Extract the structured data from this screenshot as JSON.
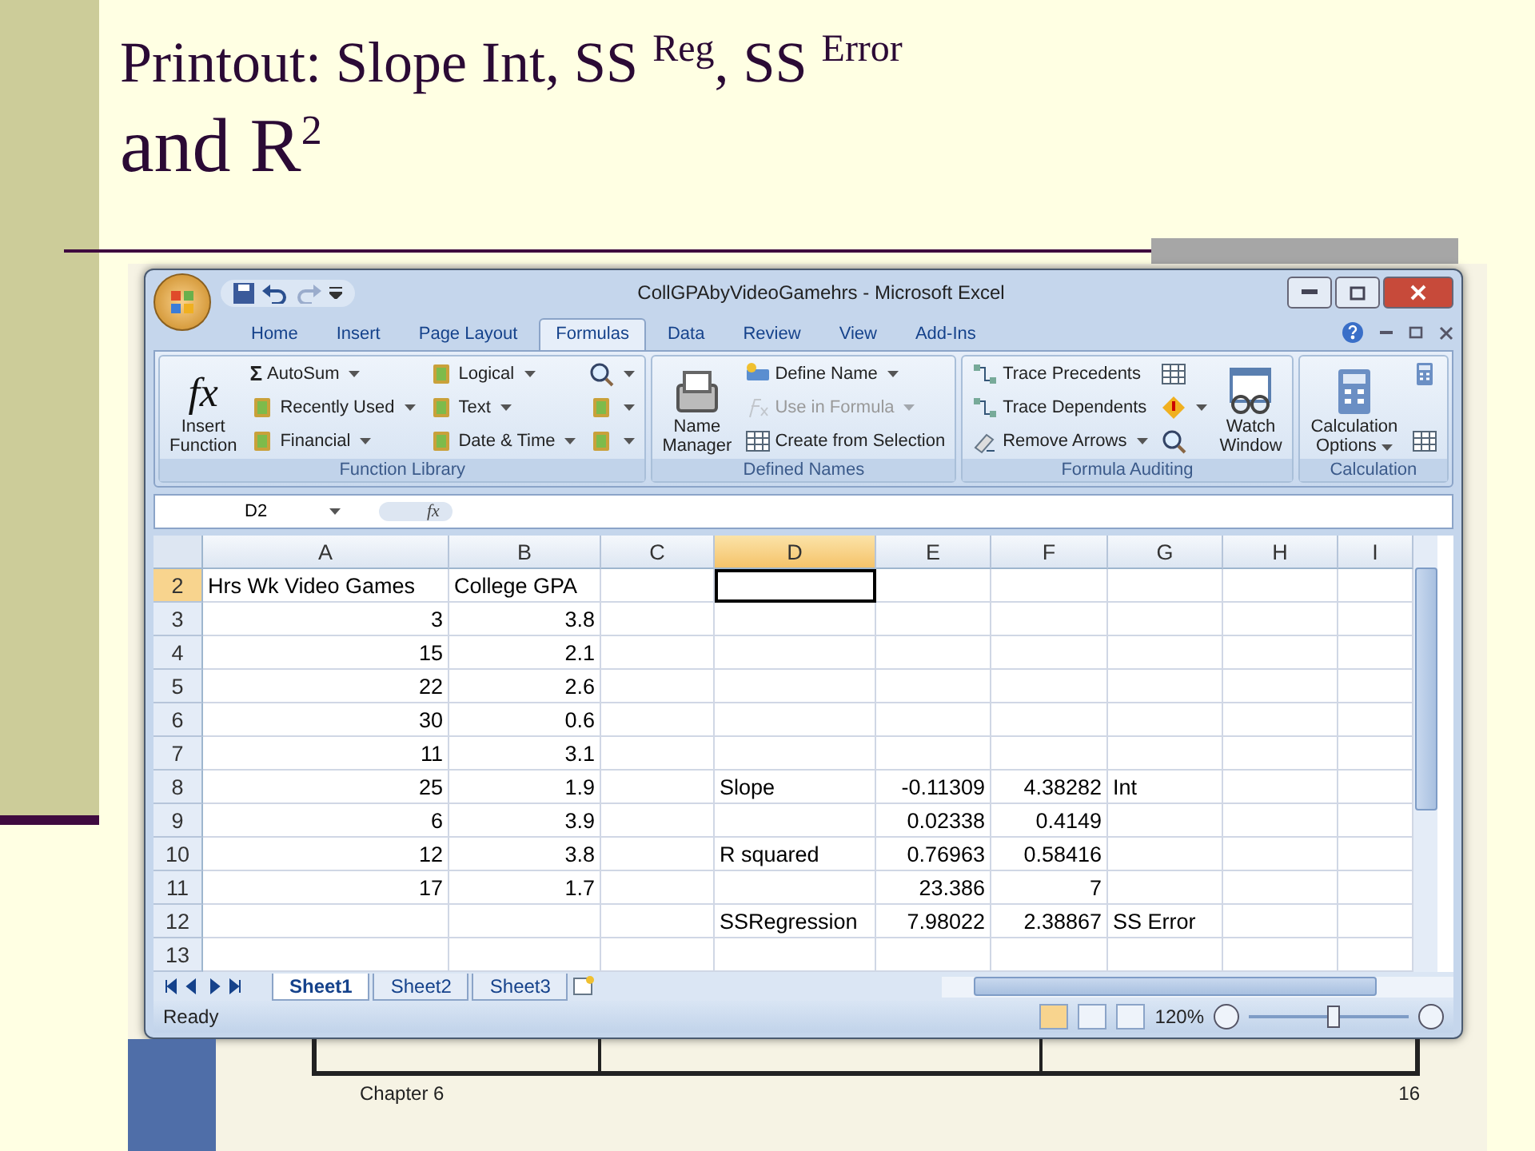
{
  "slide": {
    "title_line1": "Printout: Slope Int, SS $^{Reg}$, SS $^{Error}$",
    "title_line2": "and R$^{2}$",
    "footer_left": "Chapter 6",
    "page_number": "16"
  },
  "window": {
    "title": "CollGPAbyVideoGamehrs - Microsoft Excel"
  },
  "tabs": [
    {
      "label": "Home",
      "selected": false
    },
    {
      "label": "Insert",
      "selected": false
    },
    {
      "label": "Page Layout",
      "selected": false
    },
    {
      "label": "Formulas",
      "selected": true
    },
    {
      "label": "Data",
      "selected": false
    },
    {
      "label": "Review",
      "selected": false
    },
    {
      "label": "View",
      "selected": false
    },
    {
      "label": "Add-Ins",
      "selected": false
    }
  ],
  "ribbon": [
    {
      "label": "Function Library",
      "parts": [
        {
          "kind": "fx-button",
          "glyph": "fx",
          "label": "Insert Function"
        },
        {
          "kind": "column",
          "items": [
            {
              "kind": "sum",
              "glyph": "Σ",
              "label": "AutoSum",
              "dropdown": true,
              "disabled": false
            },
            {
              "kind": "book",
              "label": "Recently Used",
              "dropdown": true,
              "disabled": false
            },
            {
              "kind": "book",
              "label": "Financial",
              "dropdown": true,
              "disabled": false
            }
          ]
        },
        {
          "kind": "column",
          "items": [
            {
              "kind": "book",
              "label": "Logical",
              "dropdown": true,
              "disabled": false
            },
            {
              "kind": "book",
              "label": "Text",
              "dropdown": true,
              "disabled": false
            },
            {
              "kind": "book",
              "label": "Date & Time",
              "dropdown": true,
              "disabled": false
            }
          ]
        },
        {
          "kind": "column",
          "items": [
            {
              "kind": "lens",
              "dropdown": true,
              "disabled": false
            },
            {
              "kind": "book",
              "dropdown": true,
              "disabled": false
            },
            {
              "kind": "book",
              "dropdown": true,
              "disabled": false
            }
          ]
        }
      ]
    },
    {
      "label": "Defined Names",
      "parts": [
        {
          "kind": "cards-button",
          "label": "Name Manager"
        },
        {
          "kind": "column",
          "items": [
            {
              "kind": "tag",
              "label": "Define Name",
              "dropdown": true,
              "disabled": false
            },
            {
              "kind": "fxsmall",
              "label": "Use in Formula",
              "dropdown": true,
              "disabled": true
            },
            {
              "kind": "grid",
              "label": "Create from Selection",
              "dropdown": false,
              "disabled": false
            }
          ]
        }
      ]
    },
    {
      "label": "Formula Auditing",
      "parts": [
        {
          "kind": "column",
          "items": [
            {
              "kind": "arrows",
              "label": "Trace Precedents",
              "dropdown": false,
              "disabled": false
            },
            {
              "kind": "arrows",
              "label": "Trace Dependents",
              "dropdown": false,
              "disabled": false
            },
            {
              "kind": "eraser",
              "label": "Remove Arrows",
              "dropdown": true,
              "disabled": false
            }
          ]
        },
        {
          "kind": "column",
          "items": [
            {
              "kind": "grid",
              "dropdown": false,
              "disabled": false
            },
            {
              "kind": "warning",
              "dropdown": true,
              "disabled": false
            },
            {
              "kind": "lens",
              "dropdown": false,
              "disabled": false
            }
          ]
        },
        {
          "kind": "watch-button",
          "label": "Watch Window"
        }
      ]
    },
    {
      "label": "Calculation",
      "parts": [
        {
          "kind": "calc-menu-button",
          "label": "Calculation Options"
        },
        {
          "kind": "column",
          "items": [
            {
              "kind": "calc",
              "dropdown": false,
              "disabled": false
            },
            {
              "kind": "grid",
              "dropdown": false,
              "disabled": false
            }
          ]
        }
      ]
    }
  ],
  "formula_bar": {
    "name_box": "D2",
    "fx": "fx"
  },
  "columns": [
    {
      "label": "A",
      "selected": false
    },
    {
      "label": "B",
      "selected": false
    },
    {
      "label": "C",
      "selected": false
    },
    {
      "label": "D",
      "selected": true
    },
    {
      "label": "E",
      "selected": false
    },
    {
      "label": "F",
      "selected": false
    },
    {
      "label": "G",
      "selected": false
    },
    {
      "label": "H",
      "selected": false
    },
    {
      "label": "I",
      "selected": false
    }
  ],
  "rows": [
    {
      "label": "2",
      "selected": true,
      "cells": [
        {
          "kind": "text",
          "text": "Hrs Wk Video Games"
        },
        {
          "kind": "text",
          "text": "College GPA"
        },
        {
          "kind": "blank"
        },
        {
          "kind": "active"
        },
        {
          "kind": "blank"
        },
        {
          "kind": "blank"
        },
        {
          "kind": "blank"
        },
        {
          "kind": "blank"
        },
        {
          "kind": "blank"
        }
      ]
    },
    {
      "label": "3",
      "selected": false,
      "cells": [
        {
          "kind": "number",
          "text": "3"
        },
        {
          "kind": "number",
          "text": "3.8"
        },
        {
          "kind": "blank"
        },
        {
          "kind": "blank"
        },
        {
          "kind": "blank"
        },
        {
          "kind": "blank"
        },
        {
          "kind": "blank"
        },
        {
          "kind": "blank"
        },
        {
          "kind": "blank"
        }
      ]
    },
    {
      "label": "4",
      "selected": false,
      "cells": [
        {
          "kind": "number",
          "text": "15"
        },
        {
          "kind": "number",
          "text": "2.1"
        },
        {
          "kind": "blank"
        },
        {
          "kind": "blank"
        },
        {
          "kind": "blank"
        },
        {
          "kind": "blank"
        },
        {
          "kind": "blank"
        },
        {
          "kind": "blank"
        },
        {
          "kind": "blank"
        }
      ]
    },
    {
      "label": "5",
      "selected": false,
      "cells": [
        {
          "kind": "number",
          "text": "22"
        },
        {
          "kind": "number",
          "text": "2.6"
        },
        {
          "kind": "blank"
        },
        {
          "kind": "blank"
        },
        {
          "kind": "blank"
        },
        {
          "kind": "blank"
        },
        {
          "kind": "blank"
        },
        {
          "kind": "blank"
        },
        {
          "kind": "blank"
        }
      ]
    },
    {
      "label": "6",
      "selected": false,
      "cells": [
        {
          "kind": "number",
          "text": "30"
        },
        {
          "kind": "number",
          "text": "0.6"
        },
        {
          "kind": "blank"
        },
        {
          "kind": "blank"
        },
        {
          "kind": "blank"
        },
        {
          "kind": "blank"
        },
        {
          "kind": "blank"
        },
        {
          "kind": "blank"
        },
        {
          "kind": "blank"
        }
      ]
    },
    {
      "label": "7",
      "selected": false,
      "cells": [
        {
          "kind": "number",
          "text": "11"
        },
        {
          "kind": "number",
          "text": "3.1"
        },
        {
          "kind": "blank"
        },
        {
          "kind": "blank"
        },
        {
          "kind": "blank"
        },
        {
          "kind": "blank"
        },
        {
          "kind": "blank"
        },
        {
          "kind": "blank"
        },
        {
          "kind": "blank"
        }
      ]
    },
    {
      "label": "8",
      "selected": false,
      "cells": [
        {
          "kind": "number",
          "text": "25"
        },
        {
          "kind": "number",
          "text": "1.9"
        },
        {
          "kind": "blank"
        },
        {
          "kind": "text",
          "text": "Slope"
        },
        {
          "kind": "number",
          "text": "-0.11309"
        },
        {
          "kind": "number",
          "text": "4.38282"
        },
        {
          "kind": "text",
          "text": "Int"
        },
        {
          "kind": "blank"
        },
        {
          "kind": "blank"
        }
      ]
    },
    {
      "label": "9",
      "selected": false,
      "cells": [
        {
          "kind": "number",
          "text": "6"
        },
        {
          "kind": "number",
          "text": "3.9"
        },
        {
          "kind": "blank"
        },
        {
          "kind": "blank"
        },
        {
          "kind": "number",
          "text": "0.02338"
        },
        {
          "kind": "number",
          "text": "0.4149"
        },
        {
          "kind": "blank"
        },
        {
          "kind": "blank"
        },
        {
          "kind": "blank"
        }
      ]
    },
    {
      "label": "10",
      "selected": false,
      "cells": [
        {
          "kind": "number",
          "text": "12"
        },
        {
          "kind": "number",
          "text": "3.8"
        },
        {
          "kind": "blank"
        },
        {
          "kind": "text",
          "text": "R squared"
        },
        {
          "kind": "number",
          "text": "0.76963"
        },
        {
          "kind": "number",
          "text": "0.58416"
        },
        {
          "kind": "blank"
        },
        {
          "kind": "blank"
        },
        {
          "kind": "blank"
        }
      ]
    },
    {
      "label": "11",
      "selected": false,
      "cells": [
        {
          "kind": "number",
          "text": "17"
        },
        {
          "kind": "number",
          "text": "1.7"
        },
        {
          "kind": "blank"
        },
        {
          "kind": "blank"
        },
        {
          "kind": "number",
          "text": "23.386"
        },
        {
          "kind": "number",
          "text": "7"
        },
        {
          "kind": "blank"
        },
        {
          "kind": "blank"
        },
        {
          "kind": "blank"
        }
      ]
    },
    {
      "label": "12",
      "selected": false,
      "cells": [
        {
          "kind": "blank"
        },
        {
          "kind": "blank"
        },
        {
          "kind": "blank"
        },
        {
          "kind": "text",
          "text": "SSRegression"
        },
        {
          "kind": "number",
          "text": "7.98022"
        },
        {
          "kind": "number",
          "text": "2.38867"
        },
        {
          "kind": "text",
          "text": "SS Error"
        },
        {
          "kind": "blank"
        },
        {
          "kind": "blank"
        }
      ]
    },
    {
      "label": "13",
      "selected": false,
      "cells": [
        {
          "kind": "blank"
        },
        {
          "kind": "blank"
        },
        {
          "kind": "blank"
        },
        {
          "kind": "blank"
        },
        {
          "kind": "blank"
        },
        {
          "kind": "blank"
        },
        {
          "kind": "blank"
        },
        {
          "kind": "blank"
        },
        {
          "kind": "blank"
        }
      ]
    }
  ],
  "sheet_tabs": [
    {
      "label": "Sheet1",
      "selected": true
    },
    {
      "label": "Sheet2",
      "selected": false
    },
    {
      "label": "Sheet3",
      "selected": false
    }
  ],
  "status_bar": {
    "text": "Ready",
    "views": [
      {
        "selected": true
      },
      {
        "selected": false
      },
      {
        "selected": false
      }
    ],
    "zoom": "120%",
    "zoom_slider": {
      "level": 0.52
    }
  }
}
